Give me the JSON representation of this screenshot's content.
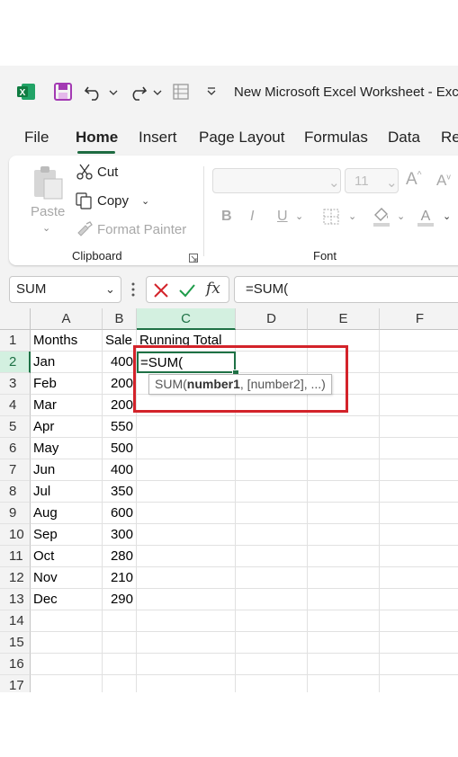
{
  "window": {
    "title": "New Microsoft Excel Worksheet  -  Exc"
  },
  "tabs": [
    {
      "label": "File"
    },
    {
      "label": "Home",
      "active": true
    },
    {
      "label": "Insert"
    },
    {
      "label": "Page Layout"
    },
    {
      "label": "Formulas"
    },
    {
      "label": "Data"
    },
    {
      "label": "Re"
    }
  ],
  "ribbon": {
    "paste_label": "Paste",
    "cut_label": "Cut",
    "copy_label": "Copy",
    "format_painter_label": "Format Painter",
    "clipboard_group": "Clipboard",
    "font_group": "Font",
    "font_size": "11",
    "bold": "B",
    "italic": "I",
    "underline": "U"
  },
  "formula_bar": {
    "name_box": "SUM",
    "formula": "=SUM(",
    "fx": "fx"
  },
  "sheet": {
    "columns": [
      "A",
      "B",
      "C",
      "D",
      "E",
      "F"
    ],
    "rows": [
      "1",
      "2",
      "3",
      "4",
      "5",
      "6",
      "7",
      "8",
      "9",
      "10",
      "11",
      "12",
      "13",
      "14",
      "15",
      "16",
      "17"
    ],
    "cells": {
      "A1": "Months",
      "B1": "Sale",
      "C1": "Running Total",
      "A2": "Jan",
      "B2": "400",
      "A3": "Feb",
      "B3": "200",
      "A4": "Mar",
      "B4": "200",
      "A5": "Apr",
      "B5": "550",
      "A6": "May",
      "B6": "500",
      "A7": "Jun",
      "B7": "400",
      "A8": "Jul",
      "B8": "350",
      "A9": "Aug",
      "B9": "600",
      "A10": "Sep",
      "B10": "300",
      "A11": "Oct",
      "B11": "280",
      "A12": "Nov",
      "B12": "210",
      "A13": "Dec",
      "B13": "290"
    },
    "active_cell_text": "=SUM(",
    "tooltip": {
      "func": "SUM(",
      "arg1": "number1",
      "rest": ", [number2], ...)"
    }
  },
  "colors": {
    "excel_green": "#1e7145",
    "highlight_red": "#d3232a",
    "save_purple": "#a33ab3"
  }
}
